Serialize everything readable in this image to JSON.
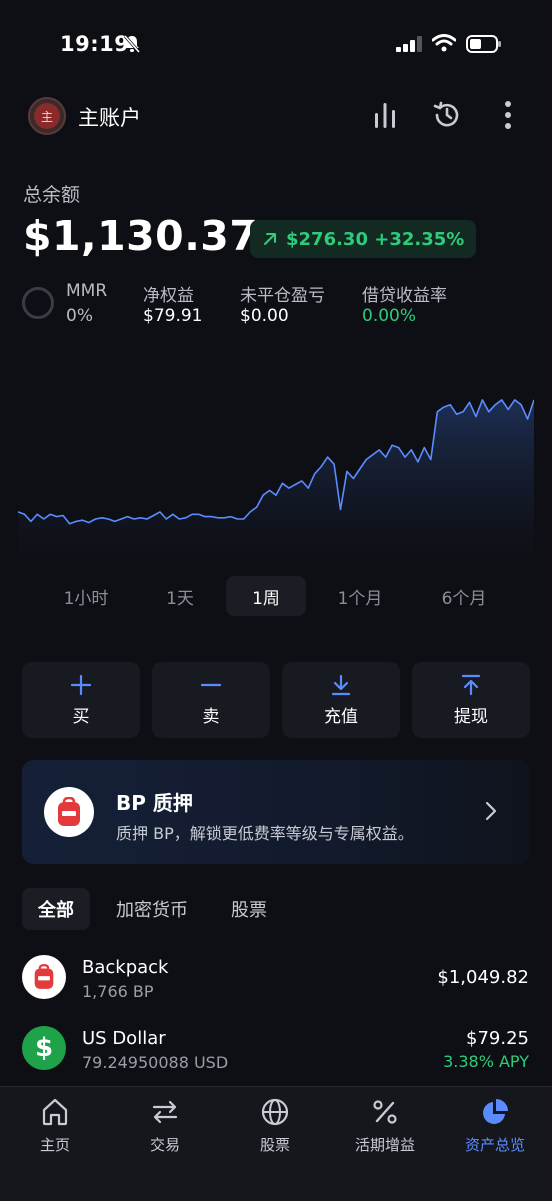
{
  "status_bar": {
    "time": "19:19"
  },
  "header": {
    "avatar_text": "主",
    "account_name": "主账户"
  },
  "balance": {
    "label": "总余额",
    "value": "$1,130.37",
    "change": "$276.30 +32.35%"
  },
  "stats": {
    "mmr_label": "MMR",
    "mmr_value": "0%",
    "items": [
      {
        "label": "净权益",
        "value": "$79.91"
      },
      {
        "label": "未平仓盈亏",
        "value": "$0.00"
      },
      {
        "label": "借贷收益率",
        "value": "0.00%"
      }
    ]
  },
  "colors": {
    "accent": "#5b8cff",
    "positive": "#2ecc7a",
    "background": "#0e0f14",
    "card": "#181a21"
  },
  "chart_data": {
    "type": "area",
    "x": [
      0,
      1,
      2,
      3,
      4,
      5,
      6,
      7,
      8,
      9,
      10,
      11,
      12,
      13,
      14,
      15,
      16,
      17,
      18,
      19,
      20,
      21,
      22,
      23,
      24,
      25,
      26,
      27,
      28,
      29,
      30,
      31,
      32,
      33,
      34,
      35,
      36,
      37,
      38,
      39,
      40,
      41,
      42,
      43,
      44,
      45,
      46,
      47,
      48,
      49,
      50,
      51,
      52,
      53,
      54,
      55,
      56,
      57,
      58,
      59,
      60,
      61,
      62,
      63,
      64,
      65,
      66,
      67,
      68,
      69,
      70,
      71,
      72,
      73,
      74,
      75,
      76,
      77,
      78,
      79,
      80
    ],
    "values": [
      1.6,
      1.5,
      1.2,
      1.5,
      1.3,
      1.5,
      1.4,
      1.45,
      1.1,
      1.2,
      1.25,
      1.15,
      1.3,
      1.35,
      1.3,
      1.2,
      1.3,
      1.4,
      1.3,
      1.35,
      1.3,
      1.45,
      1.6,
      1.3,
      1.5,
      1.3,
      1.35,
      1.5,
      1.5,
      1.4,
      1.4,
      1.35,
      1.35,
      1.4,
      1.3,
      1.3,
      1.6,
      1.8,
      2.3,
      2.5,
      2.3,
      2.8,
      2.6,
      2.75,
      2.9,
      2.6,
      3.2,
      3.5,
      3.9,
      3.6,
      1.7,
      3.3,
      3.0,
      3.4,
      3.8,
      4.0,
      4.2,
      3.9,
      4.4,
      4.3,
      3.9,
      4.2,
      3.7,
      4.3,
      3.8,
      5.8,
      6.0,
      6.1,
      5.7,
      5.8,
      6.2,
      5.6,
      6.3,
      5.8,
      6.1,
      6.3,
      5.9,
      6.3,
      6.1,
      5.5,
      6.3
    ],
    "ylim": [
      0,
      6.8
    ],
    "grid": false,
    "legend": "none"
  },
  "timeframes": [
    "1小时",
    "1天",
    "1周",
    "1个月",
    "6个月"
  ],
  "timeframe_active": "1周",
  "actions": [
    {
      "label": "买",
      "icon": "plus-icon"
    },
    {
      "label": "卖",
      "icon": "minus-icon"
    },
    {
      "label": "充值",
      "icon": "download-icon"
    },
    {
      "label": "提现",
      "icon": "upload-icon"
    }
  ],
  "promo": {
    "title": "BP 质押",
    "description": "质押 BP，解锁更低费率等级与专属权益。"
  },
  "filters": [
    "全部",
    "加密货币",
    "股票"
  ],
  "assets": [
    {
      "name": "Backpack",
      "amount": "1,766 BP",
      "value": "$1,049.82"
    },
    {
      "name": "US Dollar",
      "amount": "79.24950088 USD",
      "value": "$79.25",
      "apy": "3.38% APY"
    }
  ],
  "nav": [
    {
      "label": "主页",
      "icon": "home-icon"
    },
    {
      "label": "交易",
      "icon": "swap-icon"
    },
    {
      "label": "股票",
      "icon": "globe-icon"
    },
    {
      "label": "活期增益",
      "icon": "percent-icon"
    },
    {
      "label": "资产总览",
      "icon": "pie-chart-icon"
    }
  ]
}
